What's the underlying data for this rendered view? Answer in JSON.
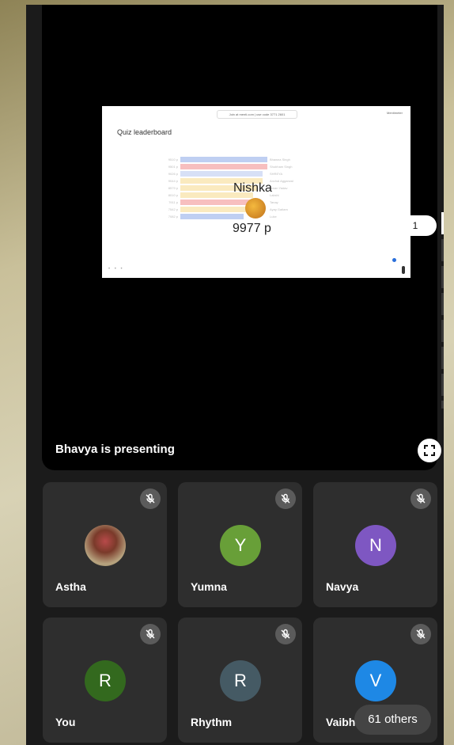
{
  "slide": {
    "join_text": "Join at menti.com | use code 3771 2601",
    "brand": "Mentimeter",
    "title": "Quiz leaderboard",
    "winner_name": "Nishka",
    "winner_score": "9977 p",
    "leaderboard": [
      {
        "score": "9510 p",
        "name": "Bhawna Singh",
        "color": "#8aa8e8"
      },
      {
        "score": "9501 p",
        "name": "Shubham Singh",
        "color": "#f08a8a"
      },
      {
        "score": "9026 p",
        "name": "SHREYA",
        "color": "#b7c7ef"
      },
      {
        "score": "9044 p",
        "name": "Anchal Aggarwal",
        "color": "#f6d98a"
      },
      {
        "score": "8579 p",
        "name": "Aman Yadav",
        "color": "#f6d98a"
      },
      {
        "score": "8010 p",
        "name": "Lakshi",
        "color": "#f6d98a"
      },
      {
        "score": "7911 p",
        "name": "Tanay",
        "color": "#f08a8a"
      },
      {
        "score": "7542 p",
        "name": "Ayay Gaitam",
        "color": "#f6d98a"
      },
      {
        "score": "7082 p",
        "name": "Luke",
        "color": "#8aa8e8"
      }
    ]
  },
  "page_indicator": "1",
  "presenting_text": "Bhavya is presenting",
  "participants": [
    {
      "name": "Astha",
      "initial": "",
      "color": "",
      "photo": true
    },
    {
      "name": "Yumna",
      "initial": "Y",
      "color": "#689f38"
    },
    {
      "name": "Navya",
      "initial": "N",
      "color": "#7e57c2"
    },
    {
      "name": "You",
      "initial": "R",
      "color": "#33691e"
    },
    {
      "name": "Rhythm",
      "initial": "R",
      "color": "#455a64"
    },
    {
      "name": "Vaibh",
      "initial": "V",
      "color": "#1e88e5"
    }
  ],
  "others_label": "61 others",
  "icons": {
    "mute": "mic-off-icon",
    "fullscreen": "fullscreen-icon"
  }
}
